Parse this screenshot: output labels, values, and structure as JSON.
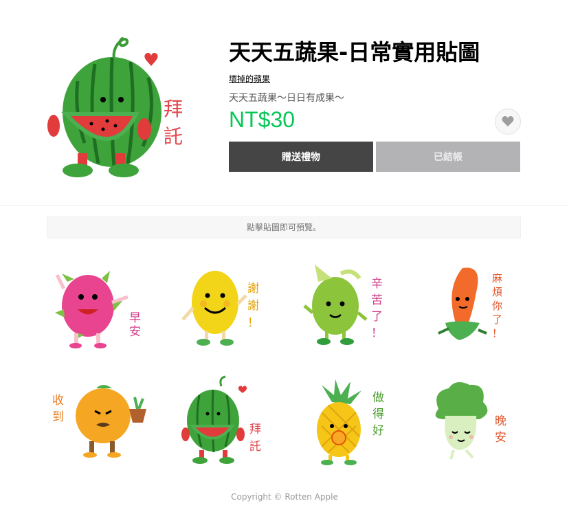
{
  "product": {
    "title": "天天五蔬果-日常實用貼圖",
    "author": "壞掉的蘋果",
    "description": "天天五蔬果〜日日有成果〜",
    "price": "NT$30",
    "gift_label": "贈送禮物",
    "owned_label": "已結帳",
    "main_sticker_caption": [
      "拜",
      "託"
    ]
  },
  "preview_notice": "點擊貼圖即可預覽。",
  "stickers": [
    {
      "fruit": "dragon-fruit",
      "caption": [
        "早",
        "安"
      ],
      "caption_color": "#d23c8a"
    },
    {
      "fruit": "lemon",
      "caption": [
        "謝",
        "謝",
        "！"
      ],
      "caption_color": "#e6a000"
    },
    {
      "fruit": "guava",
      "caption": [
        "辛",
        "苦",
        "了",
        "！"
      ],
      "caption_color": "#d23c8a"
    },
    {
      "fruit": "carrot",
      "caption": [
        "麻",
        "煩",
        "你",
        "了",
        "！"
      ],
      "caption_color": "#e2552b"
    },
    {
      "fruit": "orange",
      "caption": [
        "收",
        "到"
      ],
      "caption_color": "#e87a1a"
    },
    {
      "fruit": "watermelon",
      "caption": [
        "拜",
        "託"
      ],
      "caption_color": "#e2474d"
    },
    {
      "fruit": "pineapple",
      "caption": [
        "做",
        "得",
        "好"
      ],
      "caption_color": "#4a9d2e"
    },
    {
      "fruit": "bok-choy",
      "caption": [
        "晚",
        "安"
      ],
      "caption_color": "#e2552b"
    }
  ],
  "footer": "Copyright © Rotten Apple",
  "colors": {
    "accent": "#06c755",
    "gift_button": "#454545",
    "owned_button": "#b3b3b6"
  }
}
